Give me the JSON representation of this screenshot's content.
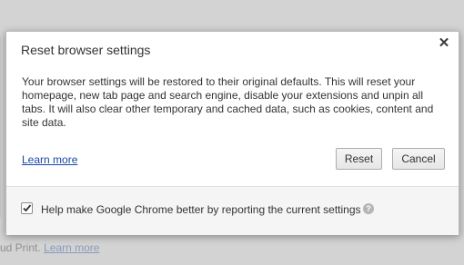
{
  "background": {
    "partial_text": "ud Print.",
    "link_text": "Learn more"
  },
  "dialog": {
    "title": "Reset browser settings",
    "close_glyph": "✕",
    "body": "Your browser settings will be restored to their original defaults. This will reset your homepage, new tab page and search engine, disable your extensions and unpin all tabs. It will also clear other temporary and cached data, such as cookies, content and site data.",
    "learn_more": "Learn more",
    "reset_label": "Reset",
    "cancel_label": "Cancel",
    "footer": {
      "checkbox_checked": true,
      "checkbox_label": "Help make Google Chrome better by reporting the current settings",
      "help_glyph": "?"
    }
  },
  "colors": {
    "link": "#1a47a6",
    "overlay": "#d3d3d3"
  }
}
